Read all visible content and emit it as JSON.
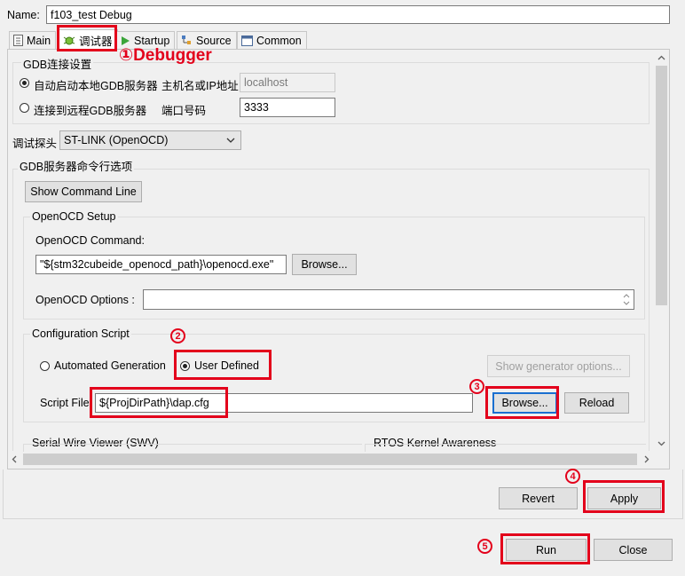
{
  "name": {
    "label": "Name:",
    "value": "f103_test Debug"
  },
  "tabs": [
    {
      "label": "Main"
    },
    {
      "label": "调试器"
    },
    {
      "label": "Startup"
    },
    {
      "label": "Source"
    },
    {
      "label": "Common"
    }
  ],
  "gdb": {
    "group_title": "GDB连接设置",
    "local_label": "自动启动本地GDB服务器",
    "remote_label": "连接到远程GDB服务器",
    "host_label": "主机名或IP地址",
    "host_value": "localhost",
    "port_label": "端口号码",
    "port_value": "3333"
  },
  "probe": {
    "label": "调试探头",
    "value": "ST-LINK (OpenOCD)"
  },
  "server_options": {
    "title": "GDB服务器命令行选项",
    "show_cmd_label": "Show Command Line"
  },
  "openocd": {
    "title": "OpenOCD Setup",
    "command_label": "OpenOCD Command:",
    "command_value": "\"${stm32cubeide_openocd_path}\\openocd.exe\"",
    "browse_label": "Browse...",
    "options_label": "OpenOCD Options :",
    "options_value": ""
  },
  "config": {
    "title": "Configuration Script",
    "auto_label": "Automated Generation",
    "user_label": "User Defined",
    "show_gen_label": "Show generator options...",
    "script_label": "Script File",
    "script_value": "${ProjDirPath}\\dap.cfg",
    "browse_label": "Browse...",
    "reload_label": "Reload"
  },
  "swv": {
    "title": "Serial Wire Viewer (SWV)"
  },
  "rtos": {
    "title": "RTOS Kernel Awareness"
  },
  "buttons": {
    "revert": "Revert",
    "apply": "Apply",
    "run": "Run",
    "close": "Close"
  },
  "annotations": {
    "a1": "①Debugger",
    "n2": "2",
    "n3": "3",
    "n4": "4",
    "n5": "5",
    "color": "#e3001b"
  }
}
